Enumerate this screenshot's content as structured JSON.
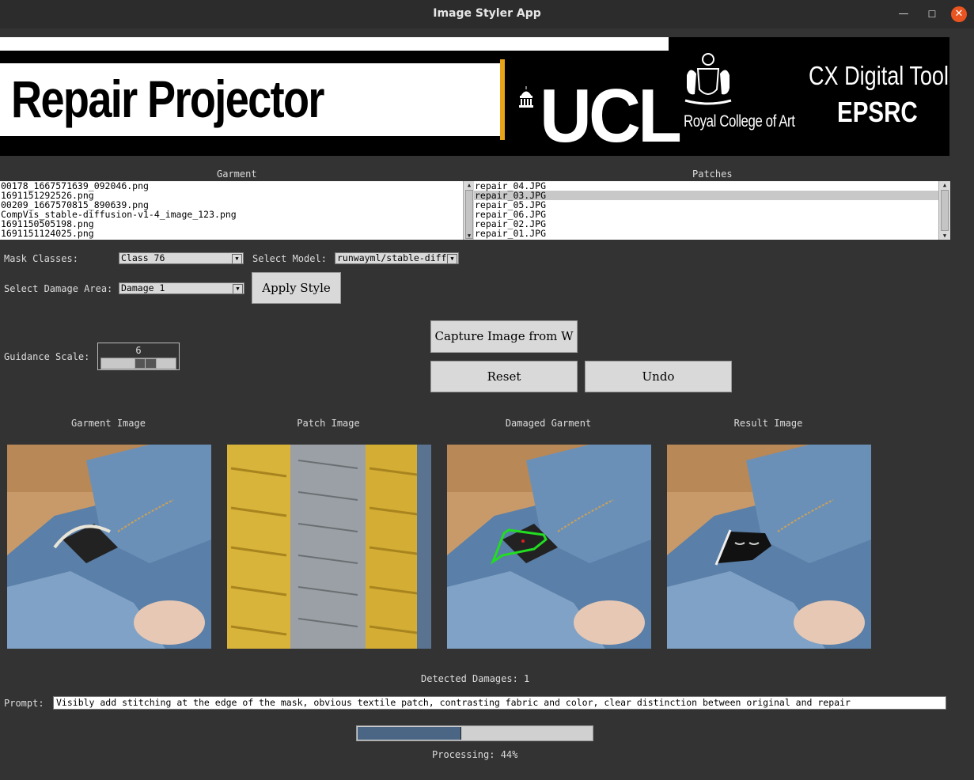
{
  "window": {
    "title": "Image Styler App",
    "minimize": "—",
    "maximize": "☐",
    "close": "✕"
  },
  "banner": {
    "left_text": "Repair Projector",
    "ucl": "UCL",
    "rca": "Royal College of Art",
    "cx_line1": "CX Digital Tools",
    "cx_line2": "EPSRC"
  },
  "garment": {
    "label": "Garment",
    "items": [
      "00178_1667571639_092046.png",
      "1691151292526.png",
      "00209_1667570815_890639.png",
      "CompVis_stable-diffusion-v1-4_image_123.png",
      "1691150505198.png",
      "1691151124025.png"
    ]
  },
  "patches": {
    "label": "Patches",
    "items": [
      "repair_04.JPG",
      "repair_03.JPG",
      "repair_05.JPG",
      "repair_06.JPG",
      "repair_02.JPG",
      "repair_01.JPG"
    ],
    "selected_index": 1
  },
  "controls": {
    "mask_classes_label": "Mask Classes:",
    "mask_classes_value": "Class 76",
    "select_model_label": "Select Model:",
    "select_model_value": "runwayml/stable-diff",
    "damage_area_label": "Select Damage Area:",
    "damage_area_value": "Damage 1",
    "apply_style": "Apply Style",
    "capture": "Capture Image from W",
    "reset": "Reset",
    "undo": "Undo",
    "guidance_label": "Guidance Scale:",
    "guidance_value": "6"
  },
  "images": {
    "garment_caption": "Garment Image",
    "patch_caption": "Patch Image",
    "damaged_caption": "Damaged Garment",
    "result_caption": "Result Image"
  },
  "detected": "Detected Damages: 1",
  "prompt": {
    "label": "Prompt:",
    "value": "Visibly add stitching at the edge of the mask, obvious textile patch, contrasting fabric and color, clear distinction between original and repair"
  },
  "progress": {
    "fraction": 0.44,
    "text": "Processing: 44%"
  },
  "colors": {
    "background": "#333333",
    "accent_close": "#e95420",
    "progress_fill": "#4a6684",
    "banner_orange": "#e8a317",
    "mask_outline": "#22dd22"
  }
}
